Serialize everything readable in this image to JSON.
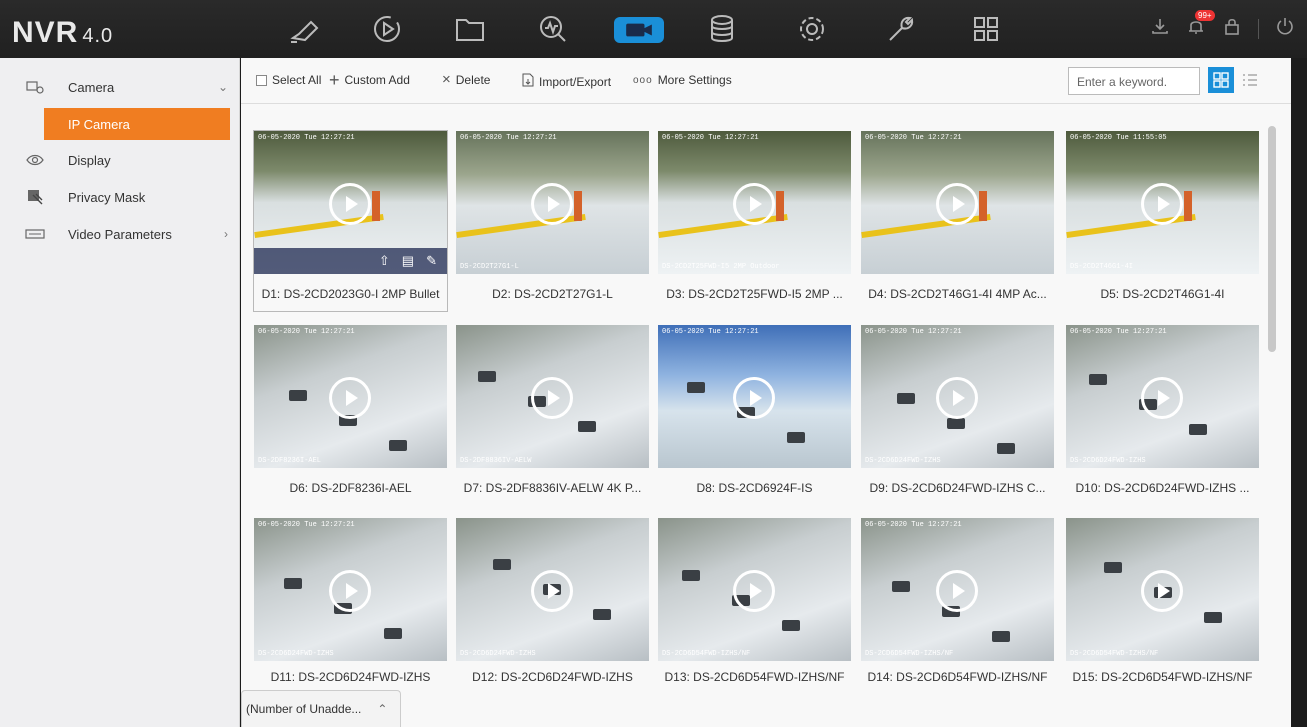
{
  "app": {
    "brand": "NVR",
    "version": "4.0"
  },
  "topnav": {
    "icons": [
      "live-view-icon",
      "playback-icon",
      "file-icon",
      "smart-analysis-icon",
      "camera-icon",
      "storage-icon",
      "system-config-icon",
      "maintenance-icon",
      "apps-icon"
    ],
    "active": "camera-icon",
    "notification_badge": "99+"
  },
  "sidebar": {
    "items": [
      {
        "label": "Camera",
        "icon": "camera-icon",
        "expanded": true
      },
      {
        "label": "Display",
        "icon": "eye-icon"
      },
      {
        "label": "Privacy Mask",
        "icon": "privacy-mask-icon"
      },
      {
        "label": "Video Parameters",
        "icon": "video-parameters-icon"
      }
    ],
    "sub_item": "IP Camera"
  },
  "toolbar": {
    "select_all": "Select All",
    "custom_add": "Custom Add",
    "delete": "Delete",
    "import_export": "Import/Export",
    "more_settings": "More Settings",
    "search_placeholder": "Enter a keyword."
  },
  "cameras": [
    {
      "caption": "D1: DS-2CD2023G0-I   2MP Bullet",
      "osd": "06-05-2020 Tue 12:27:21",
      "osd2": ""
    },
    {
      "caption": "D2: DS-2CD2T27G1-L",
      "osd": "06-05-2020 Tue 12:27:21",
      "osd2": "DS-2CD2T27G1-L"
    },
    {
      "caption": "D3: DS-2CD2T25FWD-I5   2MP ...",
      "osd": "06-05-2020 Tue 12:27:21",
      "osd2": "DS-2CD2T25FWD-I5  2MP Outdoor"
    },
    {
      "caption": "D4: DS-2CD2T46G1-4I   4MP Ac...",
      "osd": "06-05-2020 Tue 12:27:21",
      "osd2": ""
    },
    {
      "caption": "D5: DS-2CD2T46G1-4I",
      "osd": "06-05-2020 Tue 11:55:05",
      "osd2": "DS-2CD2T46G1-4I"
    },
    {
      "caption": "D6: DS-2DF8236I-AEL",
      "osd": "06-05-2020 Tue 12:27:21",
      "osd2": "DS-2DF8236I-AEL"
    },
    {
      "caption": "D7: DS-2DF8836IV-AELW   4K P...",
      "osd": "",
      "osd2": "DS-2DF8836IV-AELW"
    },
    {
      "caption": "D8: DS-2CD6924F-IS",
      "osd": "06-05-2020 Tue 12:27:21",
      "osd2": ""
    },
    {
      "caption": "D9: DS-2CD6D24FWD-IZHS   C...",
      "osd": "06-05-2020 Tue 12:27:21",
      "osd2": "DS-2CD6D24FWD-IZHS"
    },
    {
      "caption": "D10: DS-2CD6D24FWD-IZHS   ...",
      "osd": "06-05-2020 Tue 12:27:21",
      "osd2": "DS-2CD6D24FWD-IZHS"
    },
    {
      "caption": "D11: DS-2CD6D24FWD-IZHS",
      "osd": "06-05-2020 Tue 12:27:21",
      "osd2": "DS-2CD6D24FWD-IZHS"
    },
    {
      "caption": "D12: DS-2CD6D24FWD-IZHS",
      "osd": "",
      "osd2": "DS-2CD6D24FWD-IZHS"
    },
    {
      "caption": "D13: DS-2CD6D54FWD-IZHS/NF",
      "osd": "",
      "osd2": "DS-2CD6D54FWD-IZHS/NF"
    },
    {
      "caption": "D14: DS-2CD6D54FWD-IZHS/NF",
      "osd": "06-05-2020 Tue 12:27:21",
      "osd2": "DS-2CD6D54FWD-IZHS/NF"
    },
    {
      "caption": "D15: DS-2CD6D54FWD-IZHS/NF",
      "osd": "",
      "osd2": "DS-2CD6D54FWD-IZHS/NF"
    }
  ],
  "footer": {
    "unadded_label": "(Number of Unadde..."
  }
}
